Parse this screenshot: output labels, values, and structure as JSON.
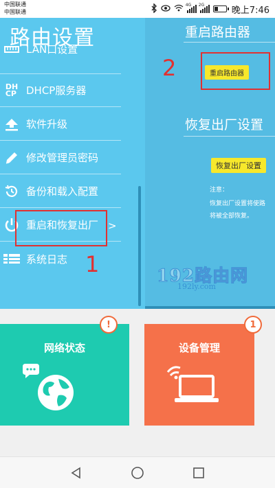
{
  "statusbar": {
    "carrier_1": "中国联通",
    "carrier_2": "中国联通",
    "signal_1_tag": "4G",
    "signal_2_tag": "2G",
    "time": "晚上7:46",
    "battery_level": 0.3
  },
  "left_panel": {
    "title": "路由设置",
    "menu": [
      {
        "label": "LAN口设置",
        "icon": "lan-icon"
      },
      {
        "label": "DHCP服务器",
        "icon": "dhcp-icon",
        "icon_text": "DH\nCP"
      },
      {
        "label": "软件升级",
        "icon": "upgrade-arrow-icon"
      },
      {
        "label": "修改管理员密码",
        "icon": "pencil-icon"
      },
      {
        "label": "备份和载入配置",
        "icon": "backup-clock-icon"
      },
      {
        "label": "重启和恢复出厂",
        "icon": "power-icon",
        "chevron": ">"
      },
      {
        "label": "系统日志",
        "icon": "list-icon"
      }
    ]
  },
  "right_panel": {
    "reboot_title": "重启路由器",
    "reboot_button": "重启路由器",
    "factory_title": "恢复出厂设置",
    "factory_button": "恢复出厂设置",
    "notice_label": "注意：",
    "notice_line1": "恢复出厂设置将使路",
    "notice_line2": "将被全部恢复。"
  },
  "watermark": {
    "line1": "192路由网",
    "line2": "192ly.com"
  },
  "annotations": {
    "step1": "1",
    "step2": "2",
    "color": "#e23030"
  },
  "cards": [
    {
      "title": "网络状态",
      "badge": "!",
      "color": "#1ecbb0",
      "icon": "chat-globe-icon"
    },
    {
      "title": "设备管理",
      "badge": "1",
      "color": "#f5714a",
      "icon": "wifi-laptop-icon"
    }
  ],
  "colors": {
    "left_panel": "#5bc8ee",
    "right_panel": "#55bce3",
    "button_yellow": "#f7e82b"
  }
}
